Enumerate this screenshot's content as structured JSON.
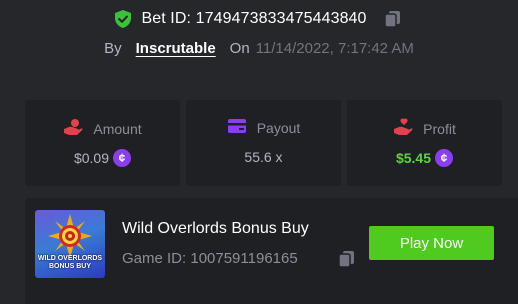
{
  "header": {
    "bet_id_text": "Bet ID: 1749473833475443840",
    "by_label": "By",
    "username": "Inscrutable",
    "on_label": "On",
    "date": "11/14/2022, 7:17:42 AM"
  },
  "stats": [
    {
      "label": "Amount",
      "value": "$0.09",
      "icon": "hand-coins-icon",
      "coin": "¢"
    },
    {
      "label": "Payout",
      "value": "55.6 x",
      "icon": "card-icon"
    },
    {
      "label": "Profit",
      "value": "$5.45",
      "icon": "hand-heart-icon",
      "coin": "¢"
    }
  ],
  "game": {
    "thumb_title": "WILD OVERLORDS BONUS BUY",
    "name": "Wild Overlords Bonus Buy",
    "id_text": "Game ID: 1007591196165",
    "play_label": "Play Now"
  },
  "colors": {
    "background": "#25272a",
    "panel": "#1e2023",
    "accent_green": "#4ecb1e",
    "profit_green": "#5fd33a",
    "icon_red": "#e4414f",
    "payout_purple": "#8a3ef0",
    "coin_purple": "#8a3ef0"
  }
}
